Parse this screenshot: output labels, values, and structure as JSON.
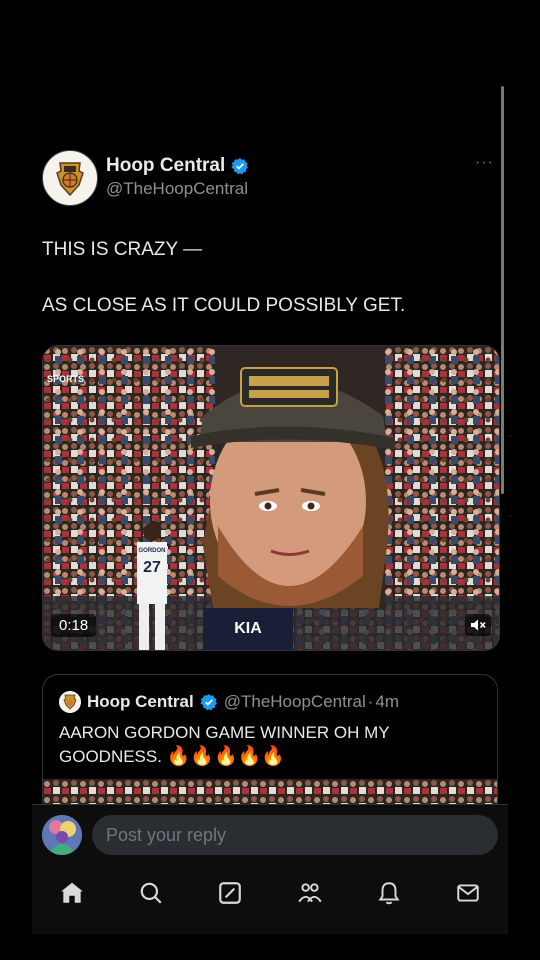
{
  "tweet": {
    "author_name": "Hoop Central",
    "author_handle": "@TheHoopCentral",
    "more_label": "···",
    "text_line1": "THIS IS CRAZY —",
    "text_line2": "AS CLOSE AS IT COULD POSSIBLY GET.",
    "video": {
      "duration": "0:18",
      "network_tag": "SPORTS",
      "player_number": "27",
      "player_name": "GORDON",
      "ad_text": "KIA"
    }
  },
  "quote": {
    "author_name": "Hoop Central",
    "author_handle": "@TheHoopCentral",
    "separator": "·",
    "time_ago": "4m",
    "text": "AARON GORDON GAME WINNER OH MY GOODNESS.",
    "emojis": "🔥🔥🔥🔥🔥"
  },
  "reply": {
    "placeholder": "Post your reply"
  },
  "colors": {
    "background": "#000000",
    "verified": "#1d9bf0",
    "secondary_text": "#8b9198",
    "border": "#2f3336"
  },
  "nav": {
    "items": [
      "home-icon",
      "search-icon",
      "compose-icon",
      "communities-icon",
      "notifications-icon",
      "messages-icon"
    ]
  }
}
